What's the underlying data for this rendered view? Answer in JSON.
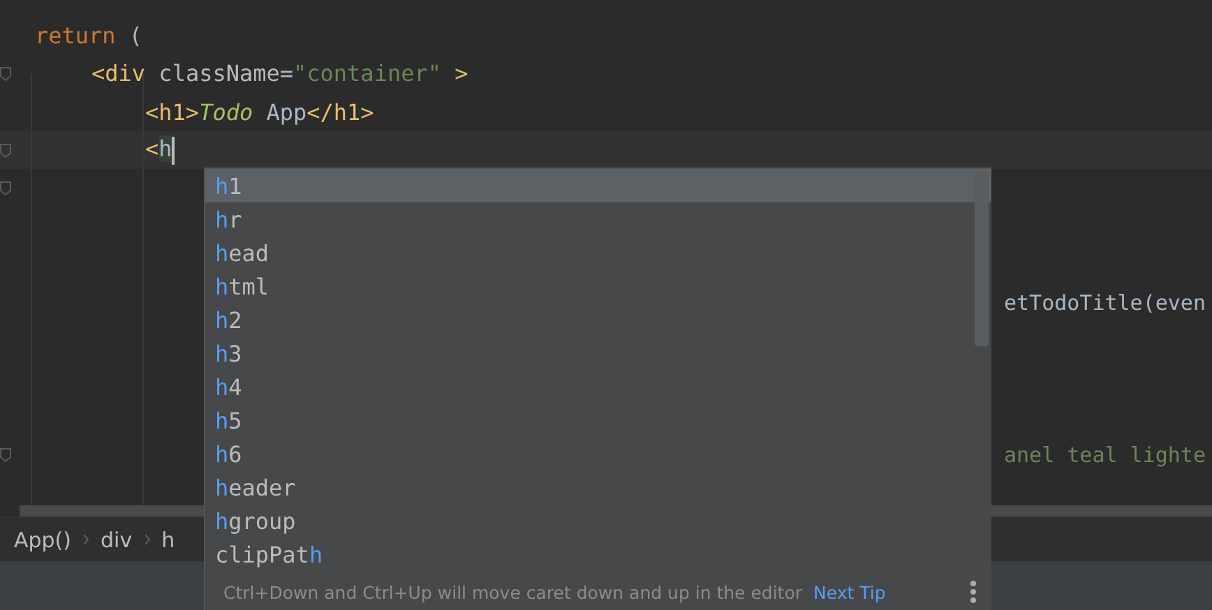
{
  "code_lines": [
    {
      "tokens": [
        {
          "text": "return",
          "kind": "keyword"
        },
        {
          "text": " (",
          "kind": "plain"
        }
      ],
      "current": false,
      "children": [
        {
          "tokens": [
            {
              "text": "<div",
              "kind": "tag"
            },
            {
              "text": " className",
              "kind": "attr"
            },
            {
              "text": "=",
              "kind": "plain"
            },
            {
              "text": "\"container\"",
              "kind": "string"
            },
            {
              "text": " >",
              "kind": "tag"
            }
          ],
          "current": false,
          "children": [
            {
              "tokens": [
                {
                  "text": "<h1>",
                  "kind": "tag"
                },
                {
                  "text": "Todo",
                  "kind": "emphasis"
                },
                {
                  "text": " App",
                  "kind": "plain"
                },
                {
                  "text": "</h1>",
                  "kind": "tag"
                }
              ],
              "current": false
            },
            {
              "tokens": [
                {
                  "text": "<",
                  "kind": "tag"
                },
                {
                  "text": "h",
                  "kind": "typed"
                }
              ],
              "current": true
            }
          ]
        }
      ]
    }
  ],
  "partial_lines": [
    {
      "text": "etTodoTitle(even",
      "kind": "plain"
    },
    {
      "text": "anel teal lighte",
      "kind": "string"
    }
  ],
  "completion": {
    "items": [
      {
        "parts": [
          {
            "text": "h",
            "match": true
          },
          {
            "text": "1",
            "match": false
          }
        ],
        "selected": true
      },
      {
        "parts": [
          {
            "text": "h",
            "match": true
          },
          {
            "text": "r",
            "match": false
          }
        ],
        "selected": false
      },
      {
        "parts": [
          {
            "text": "h",
            "match": true
          },
          {
            "text": "ead",
            "match": false
          }
        ],
        "selected": false
      },
      {
        "parts": [
          {
            "text": "h",
            "match": true
          },
          {
            "text": "tml",
            "match": false
          }
        ],
        "selected": false
      },
      {
        "parts": [
          {
            "text": "h",
            "match": true
          },
          {
            "text": "2",
            "match": false
          }
        ],
        "selected": false
      },
      {
        "parts": [
          {
            "text": "h",
            "match": true
          },
          {
            "text": "3",
            "match": false
          }
        ],
        "selected": false
      },
      {
        "parts": [
          {
            "text": "h",
            "match": true
          },
          {
            "text": "4",
            "match": false
          }
        ],
        "selected": false
      },
      {
        "parts": [
          {
            "text": "h",
            "match": true
          },
          {
            "text": "5",
            "match": false
          }
        ],
        "selected": false
      },
      {
        "parts": [
          {
            "text": "h",
            "match": true
          },
          {
            "text": "6",
            "match": false
          }
        ],
        "selected": false
      },
      {
        "parts": [
          {
            "text": "h",
            "match": true
          },
          {
            "text": "eader",
            "match": false
          }
        ],
        "selected": false
      },
      {
        "parts": [
          {
            "text": "h",
            "match": true
          },
          {
            "text": "group",
            "match": false
          }
        ],
        "selected": false
      },
      {
        "parts": [
          {
            "text": "clipPat",
            "match": false
          },
          {
            "text": "h",
            "match": true
          }
        ],
        "selected": false
      }
    ],
    "tip": "Ctrl+Down and Ctrl+Up will move caret down and up in the editor",
    "tip_link": "Next Tip"
  },
  "breadcrumbs": [
    "App()",
    "div",
    "h"
  ]
}
